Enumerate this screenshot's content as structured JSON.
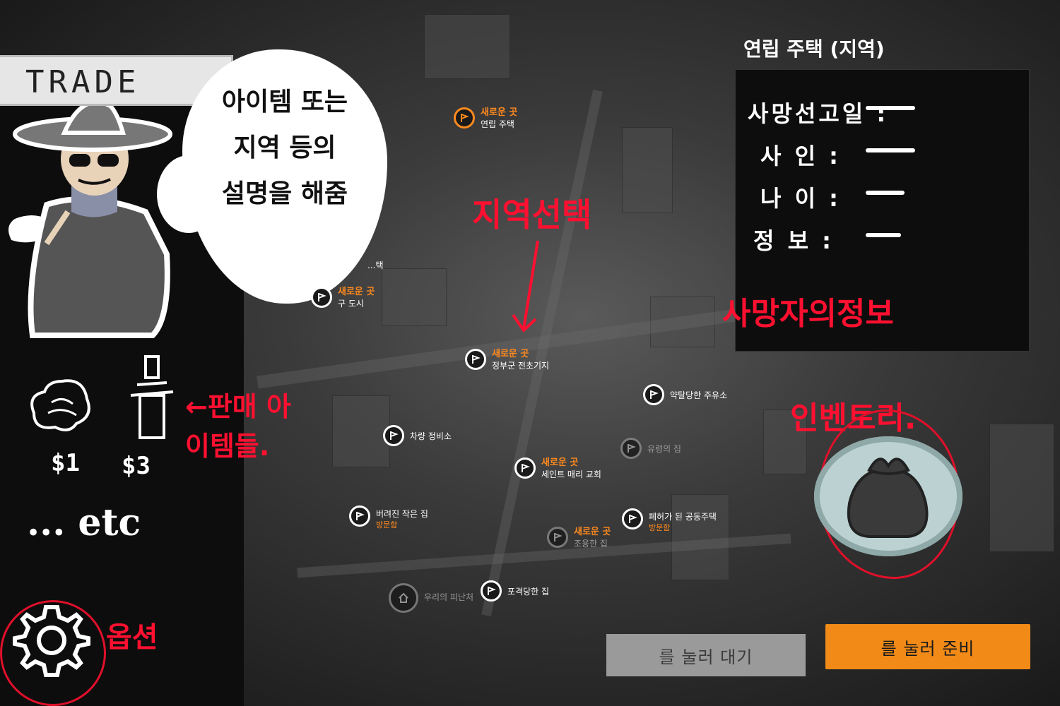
{
  "trade": {
    "title": "TRADE"
  },
  "speech_bubble": {
    "lines": [
      "아이템 또는",
      "지역 등의",
      "설명을 해줌"
    ]
  },
  "sale_items": [
    {
      "icon": "cabbage-icon",
      "price": "$1"
    },
    {
      "icon": "bottle-icon",
      "price": "$3"
    }
  ],
  "etc_text": "... etc",
  "annotations": {
    "sale_items": "←판매 아이템들.",
    "region_select": "지역선택",
    "options": "옵션",
    "deceased_info": "사망자의정보",
    "inventory": "인벤토리."
  },
  "map_markers": [
    {
      "tag": "새로운 곳",
      "name": "연립 주택",
      "style": "orange"
    },
    {
      "tag": "",
      "name": "...택",
      "style": "normal"
    },
    {
      "tag": "새로운 곳",
      "name": "구 도시",
      "style": "normal"
    },
    {
      "tag": "새로운 곳",
      "name": "정부군 전초기지",
      "style": "normal"
    },
    {
      "tag": "",
      "name": "약탈당한 주유소",
      "style": "normal"
    },
    {
      "tag": "",
      "name": "차량 정비소",
      "style": "normal"
    },
    {
      "tag": "",
      "name": "유령의 집",
      "style": "dim"
    },
    {
      "tag": "새로운 곳",
      "name": "세인트 매리 교회",
      "style": "normal"
    },
    {
      "tag": "",
      "name": "버려진 작은 집",
      "sub": "방문함",
      "style": "normal"
    },
    {
      "tag": "",
      "name": "폐허가 된 공동주택",
      "sub": "방문함",
      "style": "normal"
    },
    {
      "tag": "새로운 곳",
      "name": "조용한 집",
      "style": "dim"
    },
    {
      "tag": "",
      "name": "우리의 피난처",
      "style": "home"
    },
    {
      "tag": "",
      "name": "포격당한 집",
      "style": "normal"
    }
  ],
  "info_panel": {
    "title": "연립 주택 (지역)",
    "rows": [
      {
        "label": "사망선고일 :"
      },
      {
        "label": "사 인 :"
      },
      {
        "label": "나 이 :"
      },
      {
        "label": "정 보 :"
      }
    ]
  },
  "buttons": {
    "wait": "를 눌러 대기",
    "ready": "를 눌러 준비"
  },
  "colors": {
    "accent": "#f18a17",
    "annotation": "#ff1030"
  }
}
